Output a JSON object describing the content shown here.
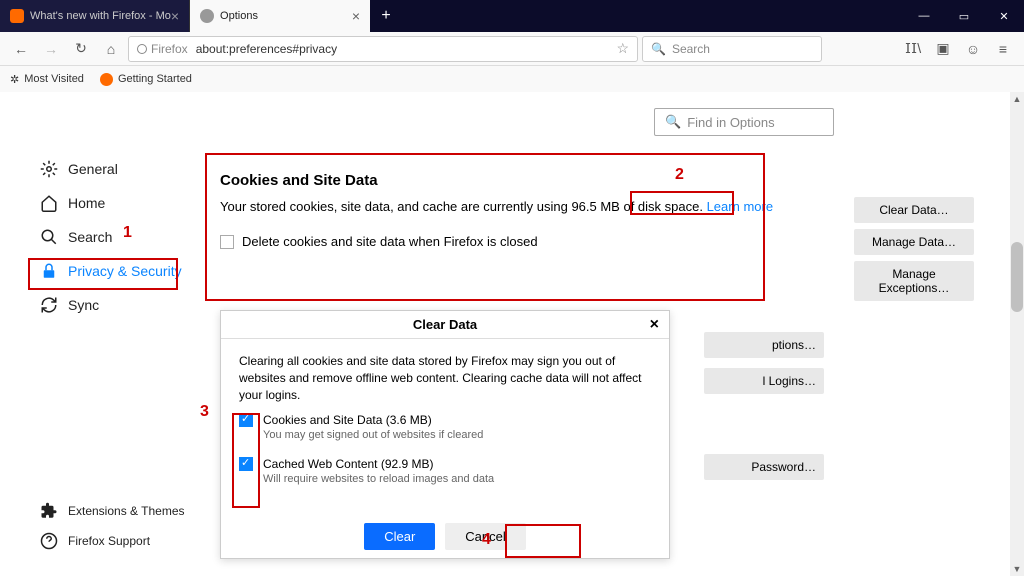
{
  "titlebar": {
    "tab1": "What's new with Firefox - Mo",
    "tab2": "Options"
  },
  "urlbar": {
    "prefix": "Firefox",
    "url": "about:preferences#privacy",
    "search_placeholder": "Search"
  },
  "bookmarks": {
    "most_visited": "Most Visited",
    "getting_started": "Getting Started"
  },
  "sidebar": {
    "general": "General",
    "home": "Home",
    "search": "Search",
    "privacy": "Privacy & Security",
    "sync": "Sync",
    "extensions": "Extensions & Themes",
    "support": "Firefox Support"
  },
  "main": {
    "search_placeholder": "Find in Options",
    "section_title": "Cookies and Site Data",
    "section_desc": "Your stored cookies, site data, and cache are currently using 96.5 MB of disk space.   ",
    "learn_more": "Learn more",
    "clear_data": "Clear Data…",
    "manage_data": "Manage Data…",
    "manage_exceptions": "Manage Exceptions…",
    "delete_on_close": "Delete cookies and site data when Firefox is closed",
    "btn_options": "ptions…",
    "btn_logins": "l Logins…",
    "btn_password": "Password…"
  },
  "dialog": {
    "title": "Clear Data",
    "desc": "Clearing all cookies and site data stored by Firefox may sign you out of websites and remove offline web content. Clearing cache data will not affect your logins.",
    "check1_title": "Cookies and Site Data (3.6 MB)",
    "check1_sub": "You may get signed out of websites if cleared",
    "check2_title": "Cached Web Content (92.9 MB)",
    "check2_sub": "Will require websites to reload images and data",
    "clear": "Clear",
    "cancel": "Cancel"
  },
  "annotations": {
    "n1": "1",
    "n2": "2",
    "n3": "3",
    "n4": "4"
  }
}
